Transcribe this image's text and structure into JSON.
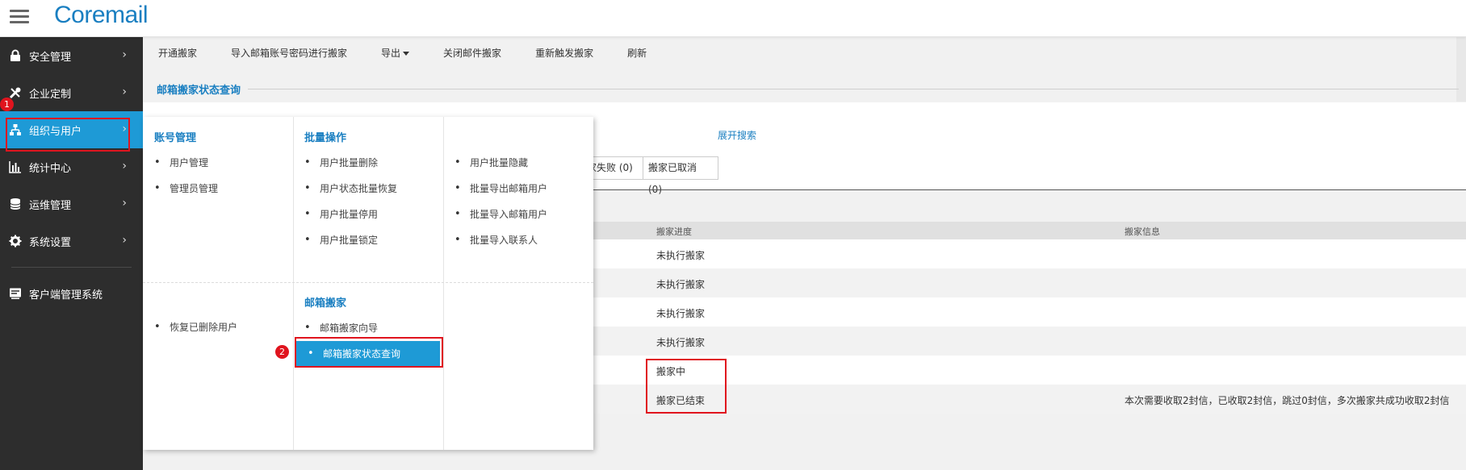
{
  "app": {
    "logo": "Coremail"
  },
  "sidebar": {
    "items": [
      {
        "label": "安全管理",
        "icon": "lock-icon"
      },
      {
        "label": "企业定制",
        "icon": "tools-icon"
      },
      {
        "label": "组织与用户",
        "icon": "org-chart-icon",
        "active": true
      },
      {
        "label": "统计中心",
        "icon": "bar-chart-icon"
      },
      {
        "label": "运维管理",
        "icon": "database-icon"
      },
      {
        "label": "系统设置",
        "icon": "gear-icon"
      }
    ],
    "client_item": {
      "label": "客户端管理系统",
      "icon": "client-console-icon"
    }
  },
  "badges": {
    "one": "1",
    "two": "2"
  },
  "toolbar": {
    "open_move": "开通搬家",
    "import_move": "导入邮箱账号密码进行搬家",
    "export": "导出",
    "close_move": "关闭邮件搬家",
    "retrigger": "重新触发搬家",
    "refresh": "刷新"
  },
  "page": {
    "section_title": "邮箱搬家状态查询",
    "expand_search": "展开搜索",
    "filter_failed": "家失败 (0)",
    "filter_cancelled": "搬家已取消 (0)"
  },
  "table": {
    "headers": {
      "progress": "搬家进度",
      "info": "搬家信息"
    },
    "rows": [
      {
        "progress": "未执行搬家",
        "info": ""
      },
      {
        "progress": "未执行搬家",
        "info": ""
      },
      {
        "progress": "未执行搬家",
        "info": ""
      },
      {
        "progress": "未执行搬家",
        "info": ""
      },
      {
        "progress": "搬家中",
        "info": ""
      },
      {
        "progress": "搬家已结束",
        "info": "本次需要收取2封信，已收取2封信，跳过0封信，多次搬家共成功收取2封信"
      }
    ]
  },
  "mega_menu": {
    "account": {
      "title": "账号管理",
      "items": [
        "用户管理",
        "管理员管理"
      ]
    },
    "batch": {
      "title": "批量操作",
      "items": [
        "用户批量删除",
        "用户状态批量恢复",
        "用户批量停用",
        "用户批量锁定"
      ]
    },
    "batch2": {
      "items": [
        "用户批量隐藏",
        "批量导出邮箱用户",
        "批量导入邮箱用户",
        "批量导入联系人"
      ]
    },
    "restore": {
      "items": [
        "恢复已删除用户"
      ]
    },
    "move": {
      "title": "邮箱搬家",
      "items": [
        "邮箱搬家向导",
        "邮箱搬家状态查询"
      ]
    }
  },
  "colors": {
    "accent": "#1e9ad6",
    "brand": "#1a7fc1",
    "highlight_red": "#e0141e",
    "sidebar_bg": "#2d2d2d"
  }
}
